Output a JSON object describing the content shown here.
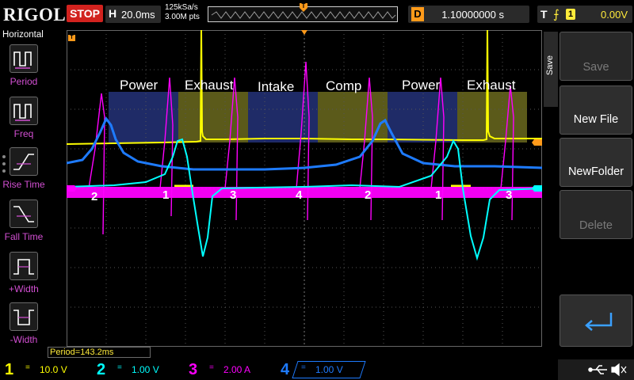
{
  "topbar": {
    "brand": "RIGOL",
    "run_state": "STOP",
    "horizontal_label": "H",
    "timebase": "20.0ms",
    "sample_rate": "125kSa/s",
    "memory_depth": "3.00M pts",
    "trigger_pos_marker": "T",
    "delay_label": "D",
    "delay_value": "1.10000000 s",
    "trigger_label": "T",
    "trigger_channel": "1",
    "trigger_level": "0.00V",
    "colors": {
      "stop": "#d2221e",
      "delay": "#ff9a1a",
      "trigger": "#ffeb3b"
    }
  },
  "left_menu": {
    "title": "Horizontal",
    "items": [
      {
        "label": "Period",
        "icon": "period-icon"
      },
      {
        "label": "Freq",
        "icon": "frequency-icon"
      },
      {
        "label": "Rise Time",
        "icon": "rise-time-icon"
      },
      {
        "label": "Fall Time",
        "icon": "fall-time-icon"
      },
      {
        "label": "+Width",
        "icon": "positive-width-icon"
      },
      {
        "label": "-Width",
        "icon": "negative-width-icon"
      }
    ]
  },
  "screen": {
    "phase_labels": [
      "Power",
      "Exhaust",
      "Intake",
      "Comp",
      "Power",
      "Exhaust"
    ],
    "cylinder_numbers": [
      "2",
      "1",
      "3",
      "4",
      "2",
      "1",
      "3"
    ],
    "measurement": "Period=143.2ms",
    "channel_colors": {
      "ch1": "#ffff00",
      "ch2": "#00ffff",
      "ch3": "#ff00ff",
      "ch4": "#1e7bff"
    }
  },
  "right_menu": {
    "side_tab": "Save",
    "buttons": [
      {
        "label": "Save",
        "enabled": false
      },
      {
        "label": "New File",
        "enabled": true
      },
      {
        "label": "NewFolder",
        "enabled": true
      },
      {
        "label": "Delete",
        "enabled": false
      }
    ],
    "enter_icon": "enter-icon"
  },
  "bottom": {
    "channels": [
      {
        "num": "1",
        "coupling": "=",
        "scale": "10.0 V",
        "color": "#ffff00"
      },
      {
        "num": "2",
        "coupling": "=",
        "scale": "1.00 V",
        "color": "#00ffff"
      },
      {
        "num": "3",
        "coupling": "=",
        "scale": "2.00 A",
        "color": "#ff00ff"
      },
      {
        "num": "4",
        "coupling": "=",
        "scale": "1.00 V",
        "color": "#1e7bff"
      }
    ],
    "icons": [
      "usb-icon",
      "speaker-mute-icon"
    ]
  }
}
